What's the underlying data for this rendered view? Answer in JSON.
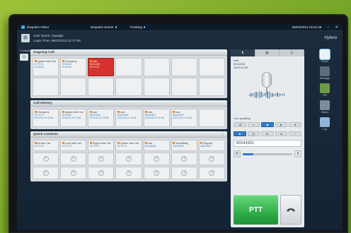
{
  "titlebar": {
    "app_name": "Dispatch Client",
    "server": "Dispatch Server",
    "trunking": "Trunking",
    "datetime": "06/02/2013 15:11:08",
    "minimize": "–",
    "close": "✕"
  },
  "user": {
    "user_name": "User Name: Supadju",
    "login_time": "Login Time: 06/02/2013 11:27:08",
    "brand": "Hytera"
  },
  "leftstrip": {
    "label": "Contacts"
  },
  "ongoing": {
    "title": "Ongoing Call",
    "cells": [
      {
        "name": "System wide Call",
        "sub": "0177171",
        "time": "01:15:06",
        "style": "normal"
      },
      {
        "name": "Emergency",
        "sub": "0175181",
        "time": "01:15:06",
        "style": "normal"
      },
      {
        "name": "user",
        "sub": "60141501",
        "time": "00:01:05",
        "style": "red"
      }
    ]
  },
  "history": {
    "title": "Call History",
    "cells": [
      {
        "name": "Emergency",
        "sub": "0177171",
        "time": "2013-04-12 11:06"
      },
      {
        "name": "System wide Call",
        "sub": "0175181",
        "time": "2013-04-12 11:06"
      },
      {
        "name": "user",
        "sub": "60141501",
        "time": "2013-04-12 11:06"
      },
      {
        "name": "user",
        "sub": "60141505",
        "time": "2013-04-12 11:06"
      },
      {
        "name": "user",
        "sub": "60141507",
        "time": "2013-04-12 11:06"
      },
      {
        "name": "user",
        "sub": "60141509",
        "time": "2013-04-12 11:06"
      }
    ]
  },
  "contacts": {
    "title": "Quick Contacts",
    "more": "⋮",
    "cells": [
      {
        "name": "All wide Call",
        "sub": "0177171"
      },
      {
        "name": "Local wide Call",
        "sub": "0177172"
      },
      {
        "name": "Region wide Call",
        "sub": "0177173"
      },
      {
        "name": "System wide Call",
        "sub": "0177174"
      },
      {
        "name": "user",
        "sub": "60140008"
      },
      {
        "name": "dennisBang",
        "sub": "10025199"
      },
      {
        "name": "Regroup",
        "sub": "60520001"
      }
    ]
  },
  "ptt": {
    "tab_icons": [
      "⬇",
      "▦",
      "☰"
    ],
    "caller_label": "user",
    "caller_id": "60141501",
    "caller_time": "15:09:02.06",
    "status": "I am speaking",
    "number": "60141501",
    "volume_fraction": 0.22,
    "ptt_label": "PTT"
  },
  "sidebar": {
    "items": [
      "Phone",
      "Message",
      "GIS",
      "History",
      "Log"
    ]
  }
}
